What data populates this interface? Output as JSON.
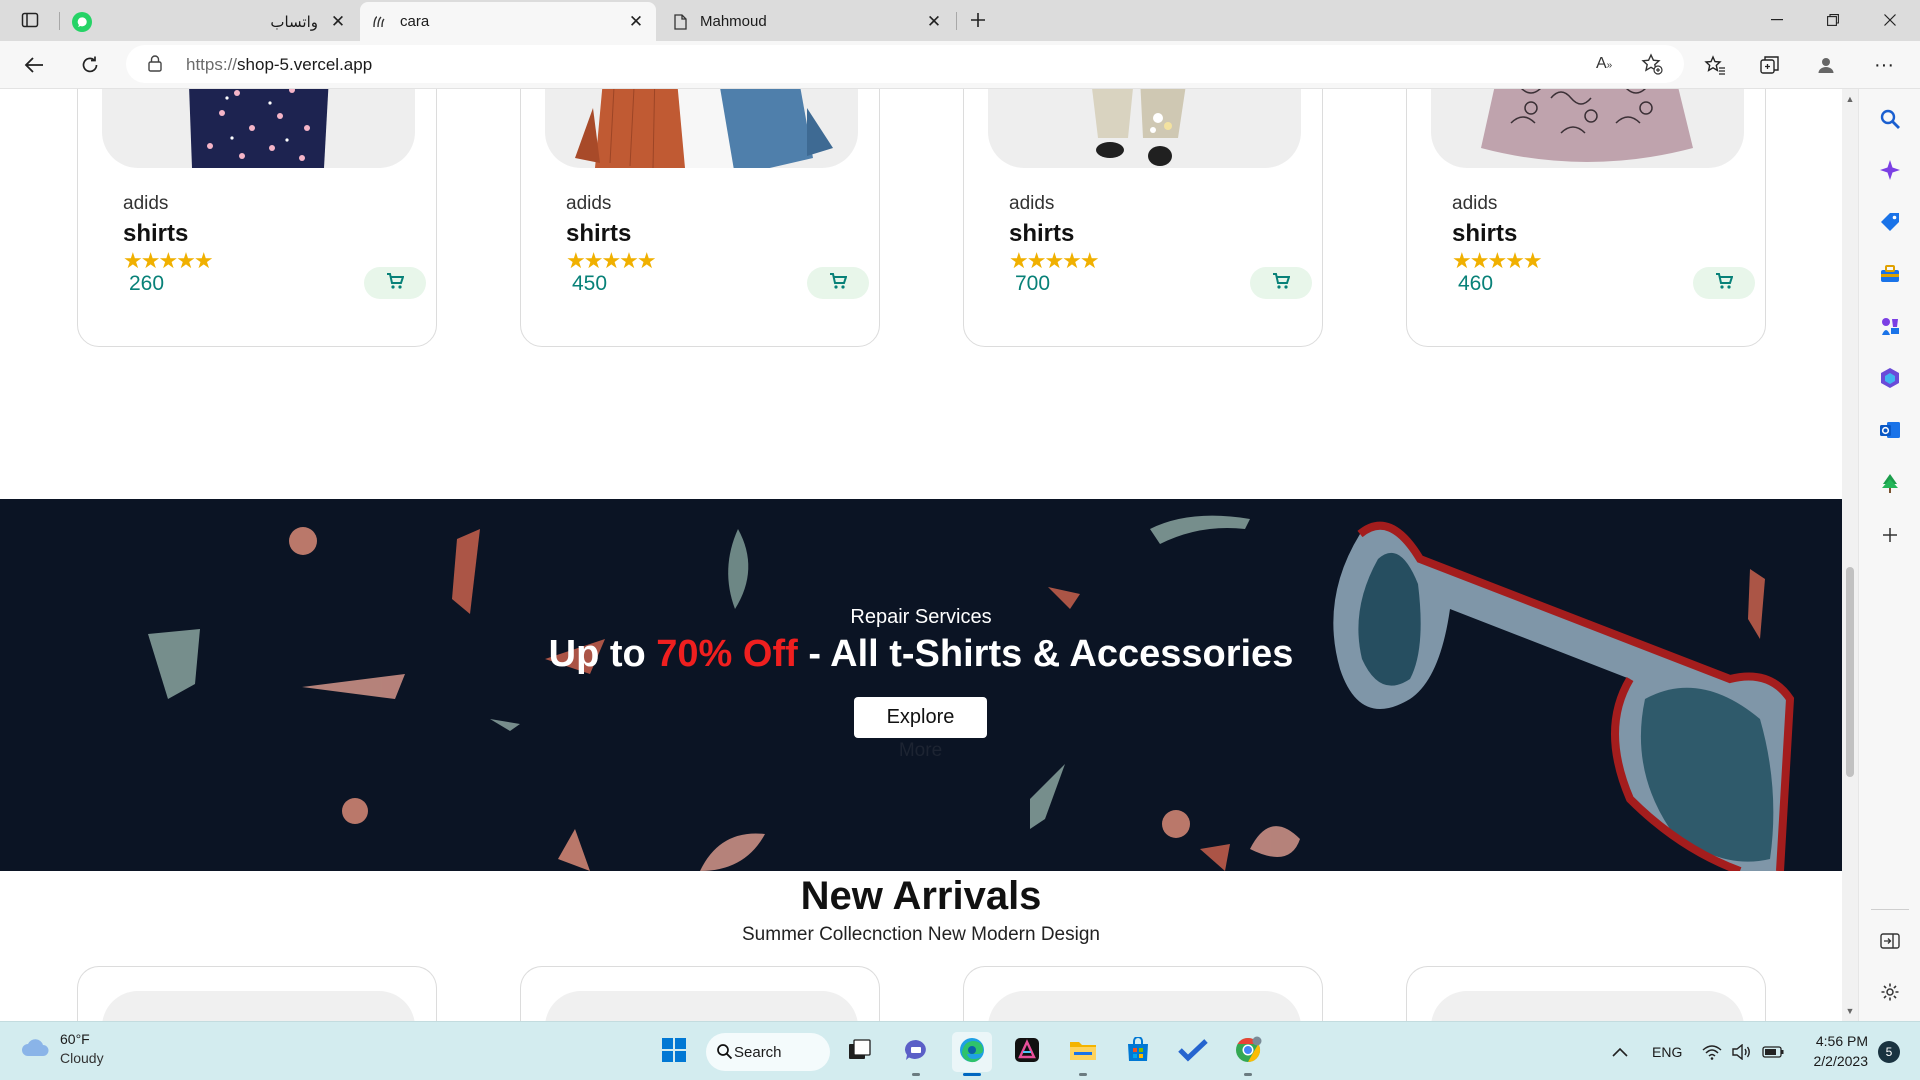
{
  "browser": {
    "tabs": [
      {
        "title": "واتساب",
        "icon": "whatsapp-icon"
      },
      {
        "title": "cara",
        "icon": "cara-logo-icon",
        "active": true
      },
      {
        "title": "Mahmoud",
        "icon": "page-icon"
      }
    ],
    "url_protocol": "https://",
    "url_host": "shop-5.vercel.app"
  },
  "featured": {
    "products": [
      {
        "brand": "adids",
        "name": "shirts",
        "rating": "★★★★★",
        "price": "260"
      },
      {
        "brand": "adids",
        "name": "shirts",
        "rating": "★★★★★",
        "price": "450"
      },
      {
        "brand": "adids",
        "name": "shirts",
        "rating": "★★★★★",
        "price": "700"
      },
      {
        "brand": "adids",
        "name": "shirts",
        "rating": "★★★★★",
        "price": "460"
      }
    ]
  },
  "banner": {
    "subtitle": "Repair Services",
    "headline_prefix": "Up to ",
    "headline_highlight": "70% Off",
    "headline_suffix": " - All t-Shirts & Accessories",
    "button_label": "Explore",
    "button_overflow": "More",
    "highlight_color": "#ef1f1f",
    "background_color": "#0b1424"
  },
  "new_arrivals": {
    "title": "New Arrivals",
    "subtitle": "Summer Collecnction New Modern Design"
  },
  "taskbar": {
    "weather_temp": "60°F",
    "weather_condition": "Cloudy",
    "search_label": "Search",
    "language": "ENG",
    "time": "4:56 PM",
    "date": "2/2/2023",
    "notification_count": "5"
  },
  "colors": {
    "price": "#088178",
    "cart_bg": "#e8f6ea",
    "star": "#f0b000"
  }
}
